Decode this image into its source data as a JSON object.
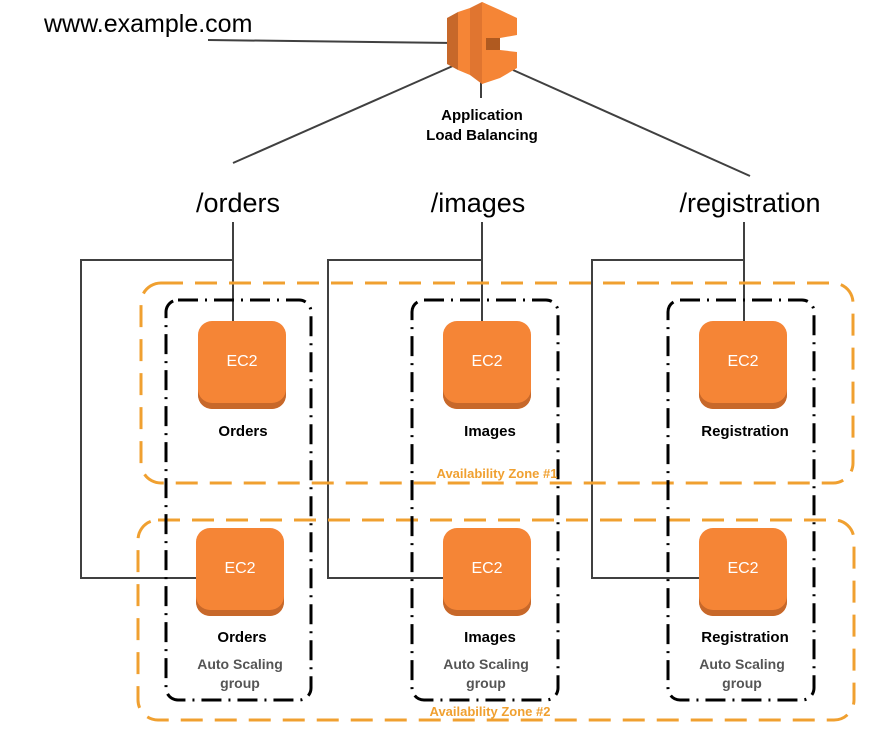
{
  "url": "www.example.com",
  "load_balancer": {
    "line1": "Application",
    "line2": "Load Balancing"
  },
  "paths": [
    "/orders",
    "/images",
    "/registration"
  ],
  "instance_label": "EC2",
  "services": [
    "Orders",
    "Images",
    "Registration"
  ],
  "asg_label": {
    "line1": "Auto Scaling",
    "line2": "group"
  },
  "zones": [
    "Availability  Zone #1",
    "Availability  Zone #2"
  ],
  "colors": {
    "orange": "#f58536",
    "zone": "#f0a030",
    "line": "#404040"
  }
}
